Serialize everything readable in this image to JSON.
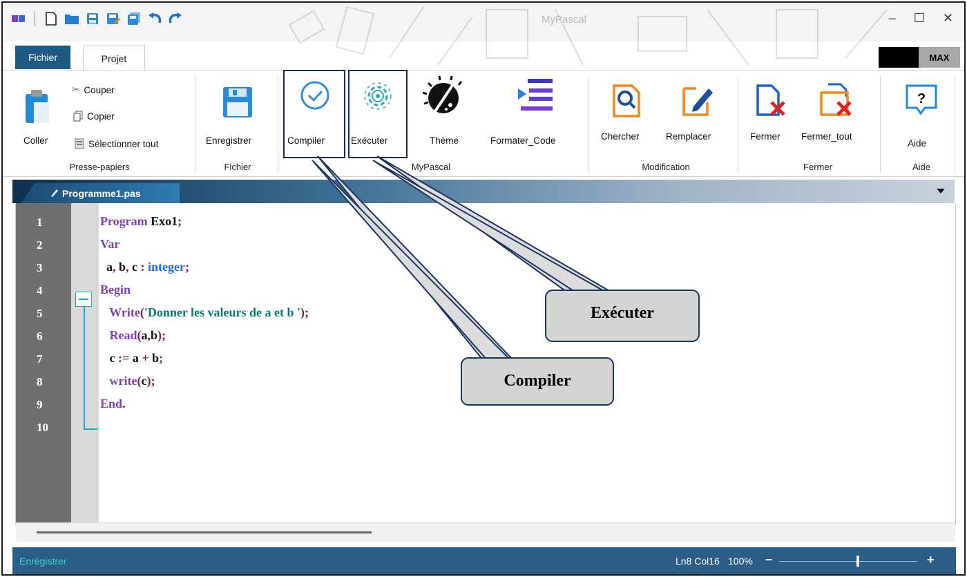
{
  "window": {
    "title": "MyPascal"
  },
  "quick_access": [
    "app-logo-icon",
    "new-file-icon",
    "open-folder-icon",
    "save-icon",
    "save-as-icon",
    "save-all-icon",
    "undo-icon",
    "redo-icon"
  ],
  "tabs": {
    "fichier": "Fichier",
    "projet": "Projet"
  },
  "max_button": "MAX",
  "ribbon": {
    "clipboard": {
      "paste": "Coller",
      "cut": "Couper",
      "copy": "Copier",
      "select_all": "Sélectionner tout",
      "group": "Presse-papiers"
    },
    "file": {
      "save": "Enregistrer",
      "group": "Fichier"
    },
    "mypascal": {
      "compile": "Compiler",
      "run": "Exécuter",
      "theme": "Thème",
      "format": "Formater_Code",
      "group": "MyPascal"
    },
    "modification": {
      "search": "Chercher",
      "replace": "Remplacer",
      "group": "Modification"
    },
    "close": {
      "close": "Fermer",
      "close_all": "Fermer_tout",
      "group": "Fermer"
    },
    "help": {
      "help": "Aide",
      "group": "Aide"
    }
  },
  "editor": {
    "tab_name": "Programme1.pas",
    "line_numbers": [
      "1",
      "2",
      "3",
      "4",
      "5",
      "6",
      "7",
      "8",
      "9",
      "10"
    ]
  },
  "status": {
    "left": "Enrégistrer",
    "position": "Ln8 Col16",
    "zoom": "100%",
    "minus": "−",
    "plus": "+"
  },
  "callouts": {
    "run": "Exécuter",
    "compile": "Compiler"
  },
  "colors": {
    "statusbar": "#2a5e86",
    "file_tab": "#1f5a82",
    "keyword": "#7e3fb8",
    "type": "#1e73d8",
    "string": "#0c7a73"
  }
}
